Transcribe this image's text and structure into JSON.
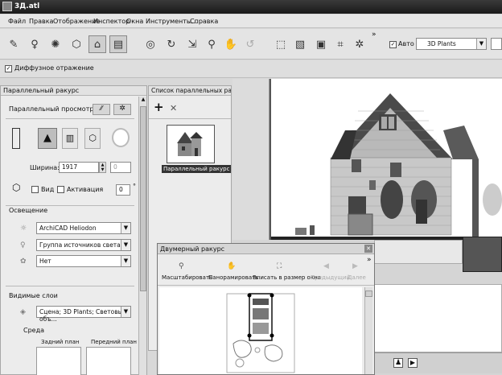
{
  "window": {
    "title": "3Д.atl"
  },
  "menu": [
    "Файл",
    "Правка",
    "Отображение",
    "Инспектор",
    "Окна",
    "Инструменты...",
    "Справка"
  ],
  "toolbar": {
    "auto_label": "Авто",
    "auto_checked": true,
    "layer_select": "3D Plants",
    "more": "»"
  },
  "optbar": {
    "diffuse_label": "Диффузное отражение",
    "diffuse_checked": true
  },
  "left_panel": {
    "title": "Параллельный ракурс",
    "projection_label": "Параллельный просмотр",
    "width_label": "Ширина:",
    "width_value": "1917",
    "second_value": "0",
    "view_label": "Вид",
    "activation_label": "Активация",
    "angle_value": "0",
    "angle_unit": "°",
    "lighting_label": "Освещение",
    "sun_select": "ArchiCAD Heliodon",
    "light_group_select": "Группа источников света",
    "none_select": "Нет",
    "visible_layers_label": "Видимые слои",
    "layers_select": "Сцена; 3D Plants; Световые объ...",
    "environment_label": "Среда",
    "back_label": "Задний план",
    "front_label": "Передний план"
  },
  "list_panel": {
    "title": "Список параллельных ракурс",
    "add_label": "+",
    "delete_label": "✕",
    "item_label": "Параллельный ракурс"
  },
  "dialog_2d": {
    "title": "Двумерный ракурс",
    "close": "✕",
    "more": "»",
    "buttons": [
      {
        "label": "Масштабировать",
        "enabled": true
      },
      {
        "label": "Панорамировать",
        "enabled": true
      },
      {
        "label": "Вписать в размер окна",
        "enabled": true
      },
      {
        "label": "Предыдущий",
        "enabled": false
      },
      {
        "label": "Далее",
        "enabled": false
      }
    ]
  }
}
